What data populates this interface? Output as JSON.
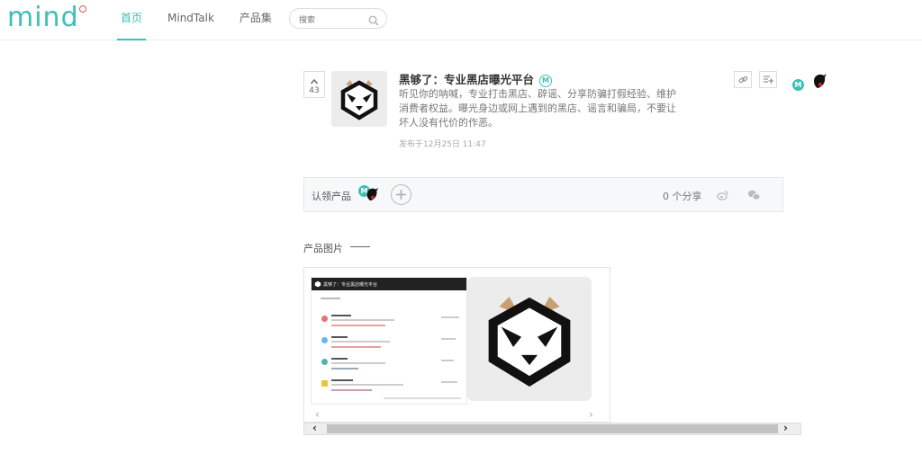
{
  "header": {
    "logo": "mind",
    "nav": [
      "首页",
      "MindTalk",
      "产品集"
    ],
    "active_nav": "首页",
    "search_placeholder": "搜索"
  },
  "product": {
    "votes": "43",
    "title": "黑够了：专业黑店曝光平台",
    "badge": "M",
    "description": "听见你的呐喊，专业打击黑店、辟谣、分享防骗打假经验、维护消费者权益。曝光身边或网上遇到的黑店、谣言和骗局，不要让坏人没有代价的作恶。",
    "published": "发布于12月25日 11:47",
    "maker_badge": "M"
  },
  "claim": {
    "label": "认领产品",
    "badge": "M",
    "share_count": "0 个分享"
  },
  "gallery": {
    "section_title": "产品图片",
    "screenshot_title": "黑够了：专业黑店曝光平台"
  },
  "colors": {
    "accent": "#3cc0b4",
    "logo_ring": "#e9573f"
  },
  "icons": [
    "search-icon",
    "chevron-up-icon",
    "link-icon",
    "add-to-list-icon",
    "plus-icon",
    "weibo-icon",
    "wechat-icon",
    "chevron-left-icon",
    "chevron-right-icon"
  ]
}
